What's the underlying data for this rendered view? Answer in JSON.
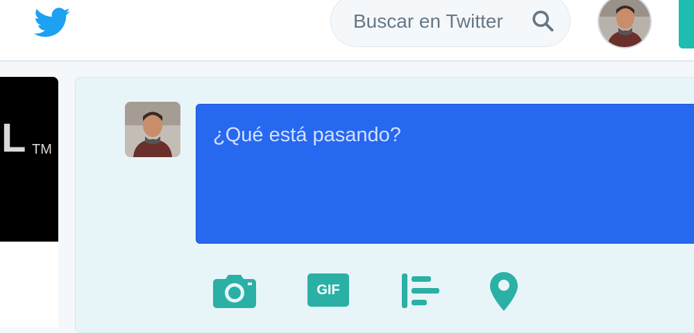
{
  "header": {
    "logo_icon": "twitter-bird-icon",
    "search": {
      "placeholder": "Buscar en Twitter",
      "icon": "search-icon"
    },
    "avatar_icon": "user-avatar"
  },
  "sidebar_card": {
    "banner_letter": "L",
    "banner_trademark": "TM"
  },
  "composer": {
    "placeholder": "¿Qué está pasando?",
    "tools": [
      {
        "name": "camera",
        "icon": "camera-icon"
      },
      {
        "name": "gif",
        "label": "GIF",
        "icon": "gif-icon"
      },
      {
        "name": "poll",
        "icon": "poll-icon"
      },
      {
        "name": "location",
        "icon": "location-pin-icon"
      }
    ]
  },
  "colors": {
    "twitter_blue": "#1da1f2",
    "accent_teal": "#2bb0a6",
    "compose_box": "#2768f0",
    "compose_bg": "#e8f5f8"
  }
}
